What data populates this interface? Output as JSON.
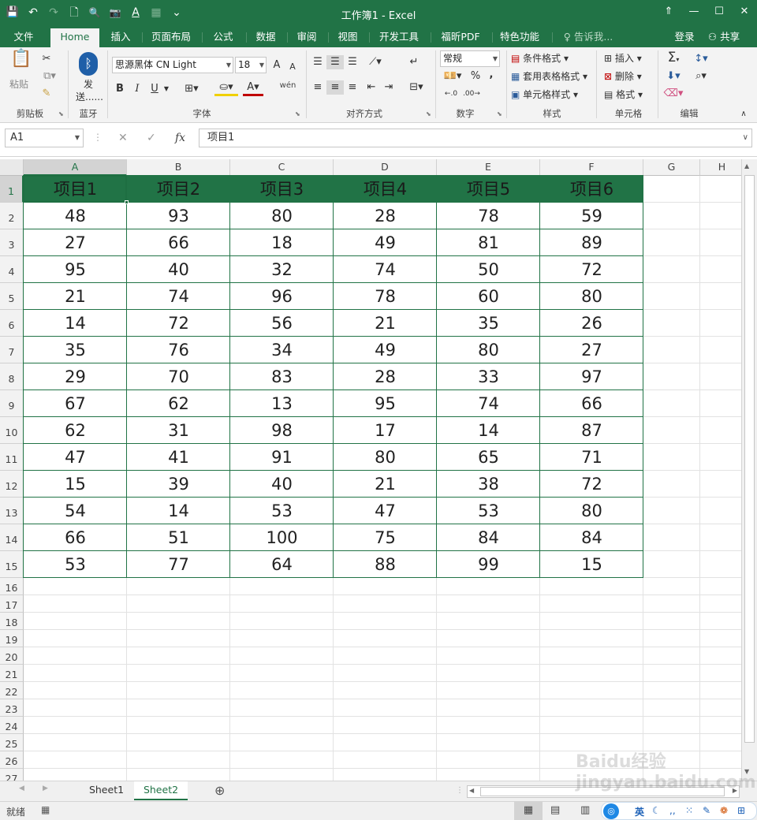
{
  "window": {
    "title": "工作簿1 - Excel",
    "qat": {
      "save": "💾",
      "undo": "↶",
      "redo": "↷",
      "new": "🗋",
      "preview": "🔍",
      "camera": "📷",
      "fontcolor": "A",
      "paint": "▦",
      "more": "⌄"
    },
    "controls": {
      "ribbon_toggle": "⇑",
      "minimize": "—",
      "maximize": "☐",
      "close": "✕"
    }
  },
  "tabs": [
    "文件",
    "Home",
    "插入",
    "页面布局",
    "公式",
    "数据",
    "审阅",
    "视图",
    "开发工具",
    "福昕PDF",
    "特色功能"
  ],
  "tellme": "告诉我...",
  "login": "登录",
  "share": "共享",
  "ribbon": {
    "clipboard": {
      "paste": "粘贴",
      "label": "剪贴板"
    },
    "bluetooth": {
      "send": "发",
      "send2": "送......",
      "label": "蓝牙"
    },
    "font": {
      "name": "思源黑体 CN Light",
      "size": "18",
      "bold": "B",
      "italic": "I",
      "underline": "U",
      "label": "字体",
      "grow": "A",
      "shrink": "A",
      "phonetic": "wén"
    },
    "alignment": {
      "label": "对齐方式"
    },
    "number": {
      "format": "常规",
      "percent": "%",
      "comma": ",",
      "label": "数字"
    },
    "styles": {
      "conditional": "条件格式",
      "table": "套用表格格式",
      "cell": "单元格样式",
      "label": "样式"
    },
    "cells": {
      "insert": "插入",
      "delete": "删除",
      "format": "格式",
      "label": "单元格"
    },
    "editing": {
      "sum": "Σ",
      "label": "编辑"
    }
  },
  "formula_bar": {
    "name_box": "A1",
    "cancel": "✕",
    "enter": "✓",
    "fx": "fx",
    "content": "项目1"
  },
  "columns": [
    "A",
    "B",
    "C",
    "D",
    "E",
    "F",
    "G",
    "H"
  ],
  "rows": [
    "1",
    "2",
    "3",
    "4",
    "5",
    "6",
    "7",
    "8",
    "9",
    "10",
    "11",
    "12",
    "13",
    "14",
    "15",
    "16",
    "17",
    "18",
    "19",
    "20",
    "21",
    "22",
    "23",
    "24",
    "25",
    "26",
    "27"
  ],
  "table": {
    "headers": [
      "项目1",
      "项目2",
      "项目3",
      "项目4",
      "项目5",
      "项目6"
    ],
    "rows": [
      [
        "48",
        "93",
        "80",
        "28",
        "78",
        "59"
      ],
      [
        "27",
        "66",
        "18",
        "49",
        "81",
        "89"
      ],
      [
        "95",
        "40",
        "32",
        "74",
        "50",
        "72"
      ],
      [
        "21",
        "74",
        "96",
        "78",
        "60",
        "80"
      ],
      [
        "14",
        "72",
        "56",
        "21",
        "35",
        "26"
      ],
      [
        "35",
        "76",
        "34",
        "49",
        "80",
        "27"
      ],
      [
        "29",
        "70",
        "83",
        "28",
        "33",
        "97"
      ],
      [
        "67",
        "62",
        "13",
        "95",
        "74",
        "66"
      ],
      [
        "62",
        "31",
        "98",
        "17",
        "14",
        "87"
      ],
      [
        "47",
        "41",
        "91",
        "80",
        "65",
        "71"
      ],
      [
        "15",
        "39",
        "40",
        "21",
        "38",
        "72"
      ],
      [
        "54",
        "14",
        "53",
        "47",
        "53",
        "80"
      ],
      [
        "66",
        "51",
        "100",
        "75",
        "84",
        "84"
      ],
      [
        "53",
        "77",
        "64",
        "88",
        "99",
        "15"
      ]
    ]
  },
  "sheets": [
    "Sheet1",
    "Sheet2"
  ],
  "active_sheet": "Sheet2",
  "add_sheet": "⊕",
  "status": {
    "ready": "就绪",
    "ime": "英"
  },
  "watermark": "Baidu经验 jingyan.baidu.com",
  "colors": {
    "accent": "#217346",
    "header_fill": "#217346"
  }
}
